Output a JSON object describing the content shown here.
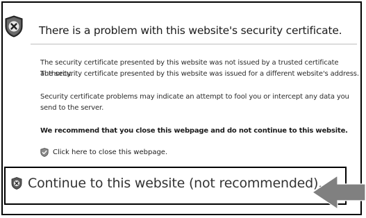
{
  "header": {
    "title": "There is a problem with this website's security certificate."
  },
  "body": {
    "line1": "The security certificate presented by this website was not issued by a trusted certificate authority.",
    "line2": "The security certificate presented by this website was issued for a different website's address.",
    "line3": "Security certificate problems may indicate an attempt to fool you or intercept any data you send to the server.",
    "recommendation": "We recommend that you close this webpage and do not continue to this website."
  },
  "actions": {
    "close_label": "Click here to close this webpage.",
    "continue_label": "Continue to this website (not recommended)."
  },
  "icons": {
    "header": "shield-error-icon",
    "close": "shield-check-icon",
    "continue": "shield-error-icon",
    "callout": "arrow-left-icon"
  },
  "colors": {
    "shield_dark": "#2f2f2f",
    "shield_light": "#9a9a9a",
    "arrow": "#808080"
  }
}
